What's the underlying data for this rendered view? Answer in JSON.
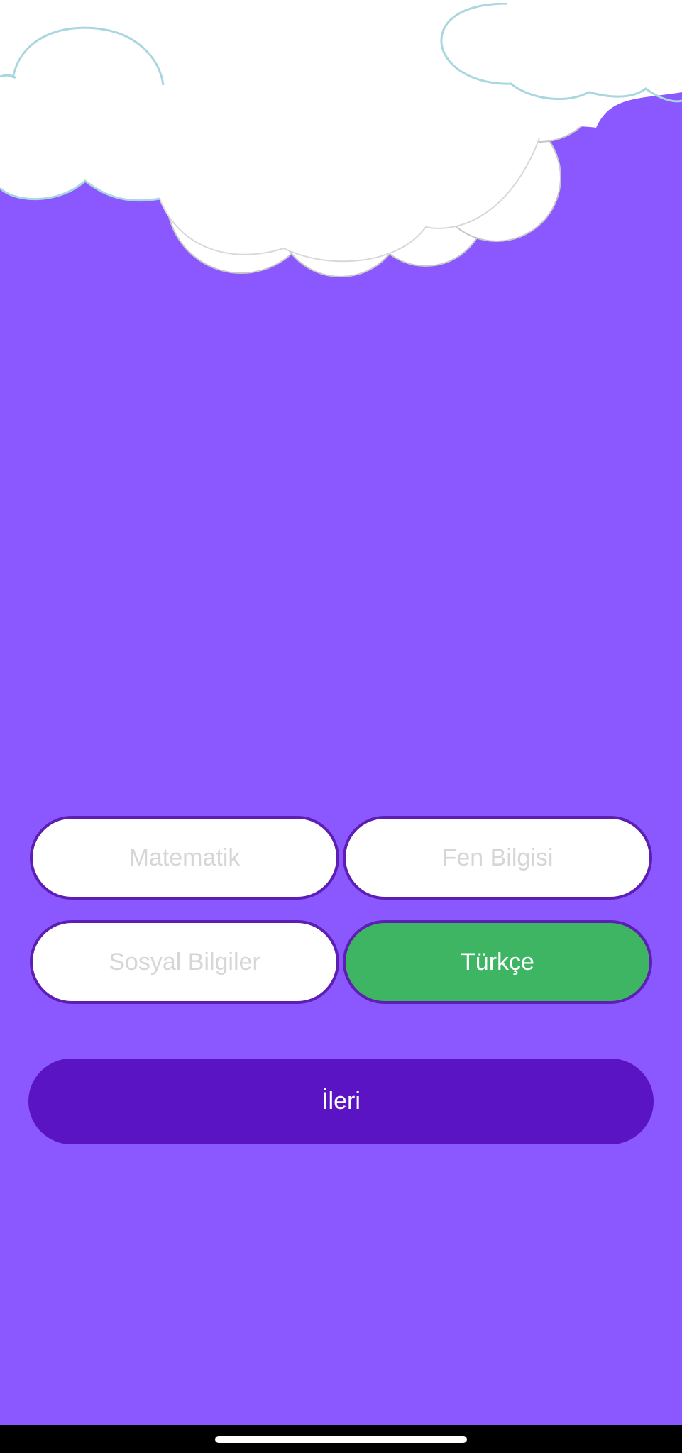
{
  "subjects": [
    {
      "label": "Matematik",
      "selected": false
    },
    {
      "label": "Fen Bilgisi",
      "selected": false
    },
    {
      "label": "Sosyal Bilgiler",
      "selected": false
    },
    {
      "label": "Türkçe",
      "selected": true
    }
  ],
  "next_button": {
    "label": "İleri"
  },
  "colors": {
    "background": "#8b57ff",
    "selected": "#3db563",
    "next_button": "#5b14c3",
    "button_border": "#5d1fb3"
  }
}
